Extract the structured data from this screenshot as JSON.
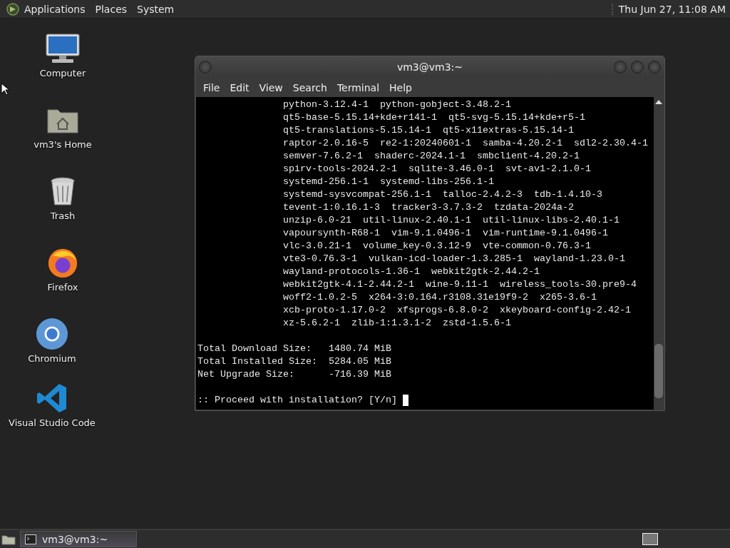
{
  "top_panel": {
    "menus": [
      "Applications",
      "Places",
      "System"
    ],
    "clock": "Thu Jun 27, 11:08 AM"
  },
  "desktop_icons": [
    {
      "kind": "computer",
      "label": "Computer"
    },
    {
      "kind": "folder",
      "label": "vm3's Home"
    },
    {
      "kind": "trash",
      "label": "Trash"
    },
    {
      "kind": "firefox",
      "label": "Firefox"
    },
    {
      "kind": "chromium",
      "label": "Chromium"
    },
    {
      "kind": "vscode",
      "label": "Visual Studio Code"
    }
  ],
  "terminal": {
    "title": "vm3@vm3:~",
    "menu": [
      "File",
      "Edit",
      "View",
      "Search",
      "Terminal",
      "Help"
    ],
    "package_lines": [
      "python-3.12.4-1  python-gobject-3.48.2-1",
      "qt5-base-5.15.14+kde+r141-1  qt5-svg-5.15.14+kde+r5-1",
      "qt5-translations-5.15.14-1  qt5-x11extras-5.15.14-1",
      "raptor-2.0.16-5  re2-1:20240601-1  samba-4.20.2-1  sdl2-2.30.4-1",
      "semver-7.6.2-1  shaderc-2024.1-1  smbclient-4.20.2-1",
      "spirv-tools-2024.2-1  sqlite-3.46.0-1  svt-av1-2.1.0-1",
      "systemd-256.1-1  systemd-libs-256.1-1",
      "systemd-sysvcompat-256.1-1  talloc-2.4.2-3  tdb-1.4.10-3",
      "tevent-1:0.16.1-3  tracker3-3.7.3-2  tzdata-2024a-2",
      "unzip-6.0-21  util-linux-2.40.1-1  util-linux-libs-2.40.1-1",
      "vapoursynth-R68-1  vim-9.1.0496-1  vim-runtime-9.1.0496-1",
      "vlc-3.0.21-1  volume_key-0.3.12-9  vte-common-0.76.3-1",
      "vte3-0.76.3-1  vulkan-icd-loader-1.3.285-1  wayland-1.23.0-1",
      "wayland-protocols-1.36-1  webkit2gtk-2.44.2-1",
      "webkit2gtk-4.1-2.44.2-1  wine-9.11-1  wireless_tools-30.pre9-4",
      "woff2-1.0.2-5  x264-3:0.164.r3108.31e19f9-2  x265-3.6-1",
      "xcb-proto-1.17.0-2  xfsprogs-6.8.0-2  xkeyboard-config-2.42-1",
      "xz-5.6.2-1  zlib-1:1.3.1-2  zstd-1.5.6-1"
    ],
    "summary_lines": [
      "Total Download Size:   1480.74 MiB",
      "Total Installed Size:  5284.05 MiB",
      "Net Upgrade Size:      -716.39 MiB"
    ],
    "prompt": ":: Proceed with installation? [Y/n]"
  },
  "taskbar": {
    "tasks": [
      {
        "label": "vm3@vm3:~",
        "selected": true
      }
    ]
  }
}
